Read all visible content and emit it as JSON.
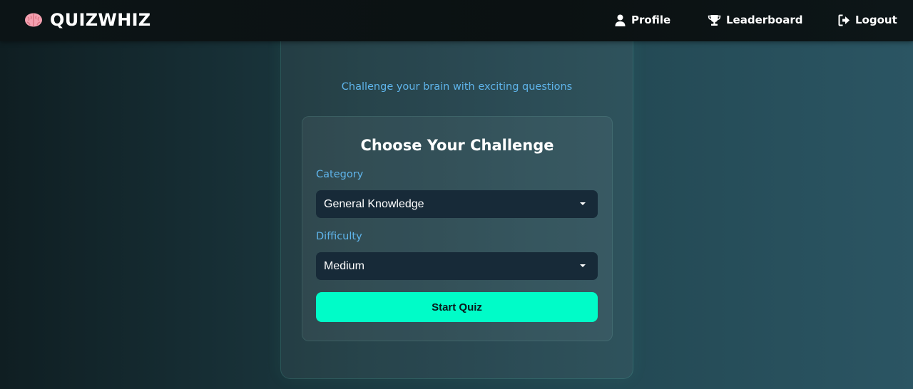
{
  "brand": {
    "name": "QUIZWHIZ",
    "icon": "brain-icon"
  },
  "nav": {
    "profile": {
      "label": "Profile",
      "icon": "user-icon"
    },
    "leaderboard": {
      "label": "Leaderboard",
      "icon": "trophy-icon"
    },
    "logout": {
      "label": "Logout",
      "icon": "logout-icon"
    }
  },
  "hero": {
    "subtitle": "Challenge your brain with exciting questions"
  },
  "panel": {
    "title": "Choose Your Challenge",
    "category": {
      "label": "Category",
      "value": "General Knowledge"
    },
    "difficulty": {
      "label": "Difficulty",
      "value": "Medium"
    },
    "start_label": "Start Quiz"
  },
  "colors": {
    "accent": "#00fcc8",
    "label_blue": "#5fb4ea",
    "select_bg": "#172a38",
    "brain_pink": "#f4a0b0"
  }
}
